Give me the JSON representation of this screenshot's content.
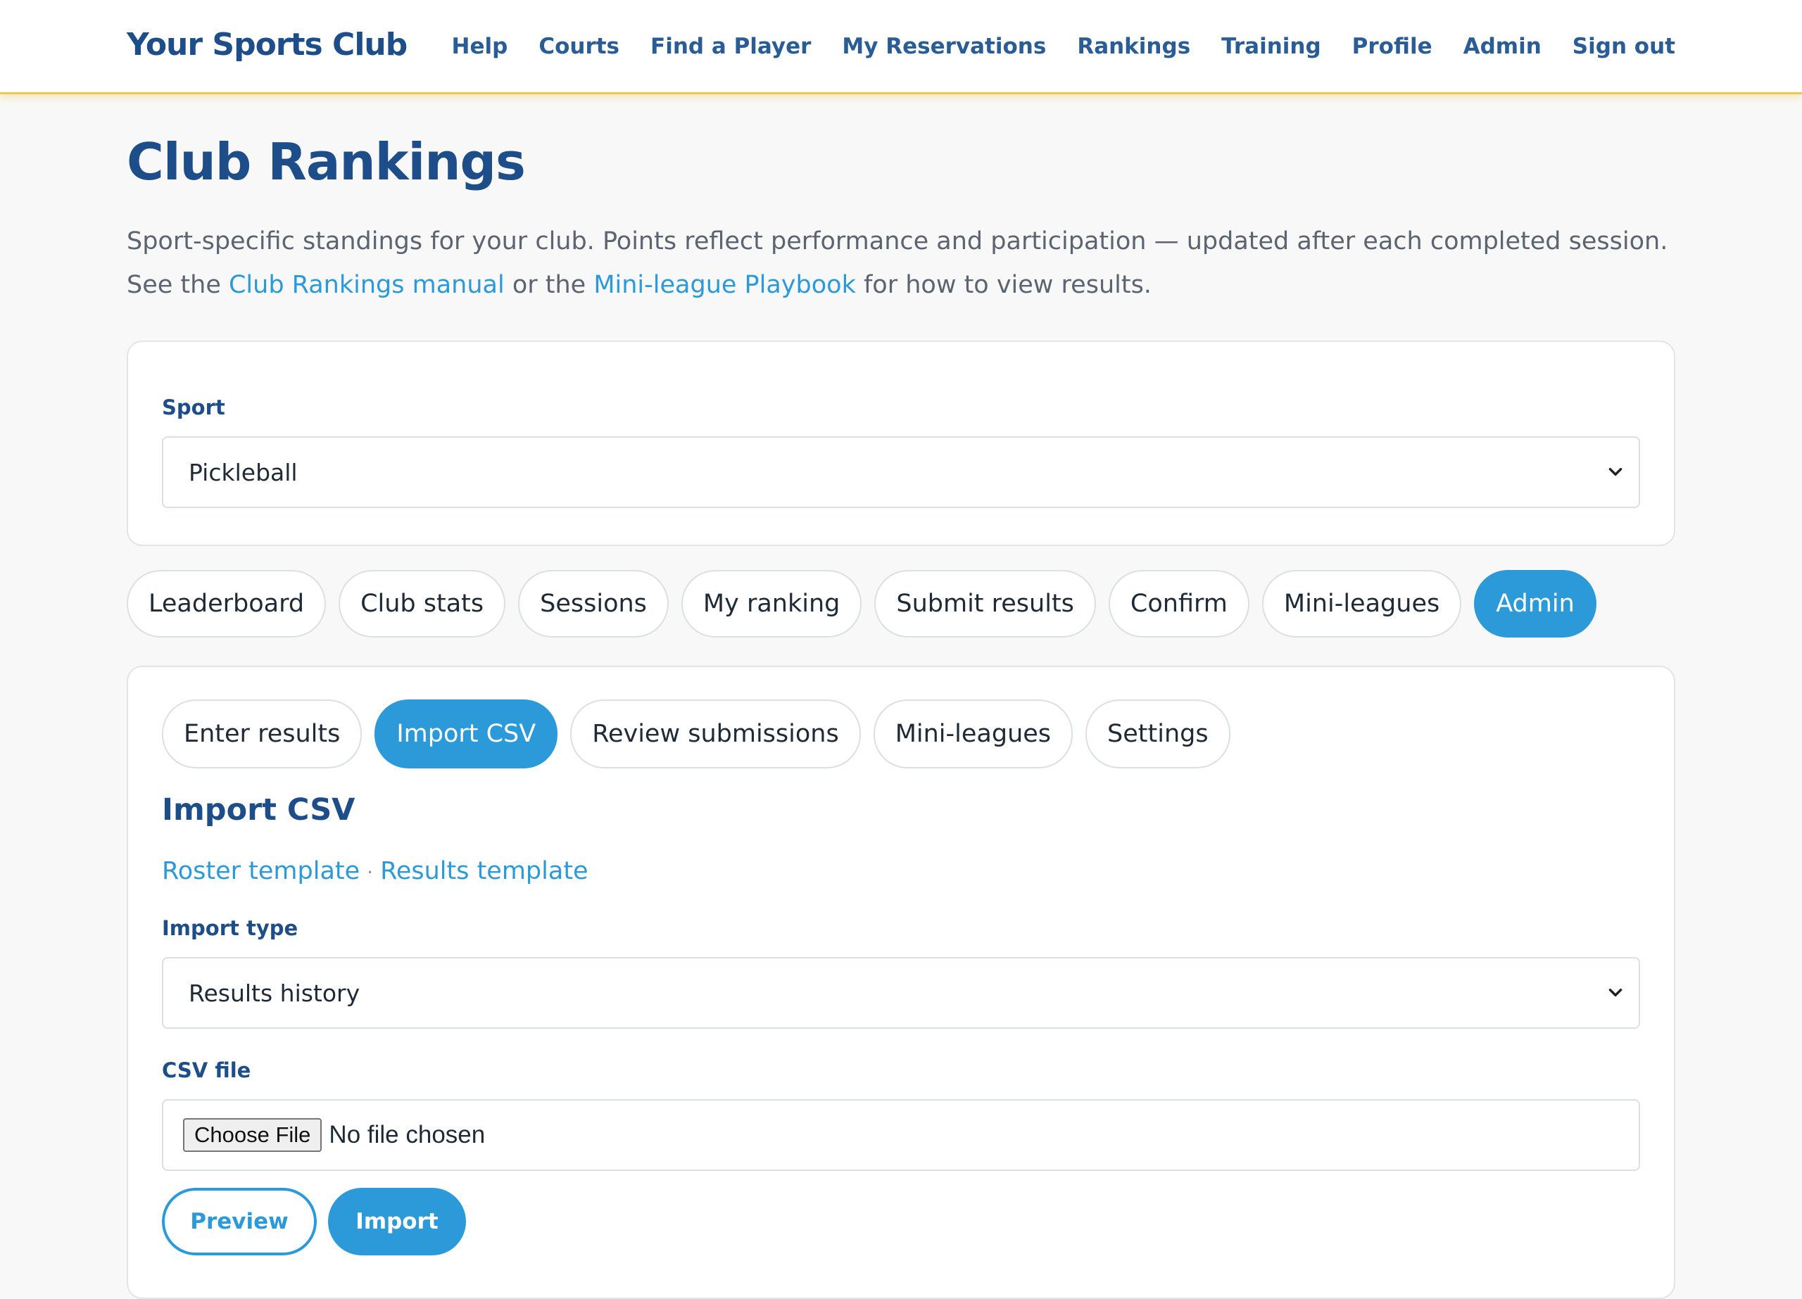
{
  "header": {
    "brand": "Your Sports Club",
    "nav": [
      "Help",
      "Courts",
      "Find a Player",
      "My Reservations",
      "Rankings",
      "Training",
      "Profile",
      "Admin",
      "Sign out"
    ]
  },
  "page": {
    "title": "Club Rankings",
    "intro_text_1": "Sport-specific standings for your club. Points reflect performance and participation — updated after each completed session. See the ",
    "intro_link_1": "Club Rankings manual",
    "intro_text_2": " or the ",
    "intro_link_2": "Mini-league Playbook",
    "intro_text_3": " for how to view results."
  },
  "sport": {
    "label": "Sport",
    "selected": "Pickleball"
  },
  "tabs": [
    "Leaderboard",
    "Club stats",
    "Sessions",
    "My ranking",
    "Submit results",
    "Confirm",
    "Mini-leagues",
    "Admin"
  ],
  "active_tab": "Admin",
  "admin": {
    "subtabs": [
      "Enter results",
      "Import CSV",
      "Review submissions",
      "Mini-leagues",
      "Settings"
    ],
    "active_subtab": "Import CSV",
    "section_title": "Import CSV",
    "roster_template": "Roster template",
    "template_sep": "·",
    "results_template": "Results template",
    "import_type_label": "Import type",
    "import_type_selected": "Results history",
    "csv_file_label": "CSV file",
    "choose_file": "Choose File",
    "file_status": "No file chosen",
    "preview_button": "Preview",
    "import_button": "Import"
  },
  "colors": {
    "brand": "#1d4e89",
    "accent": "#2c9ad9",
    "header_border": "#f2c84b"
  }
}
